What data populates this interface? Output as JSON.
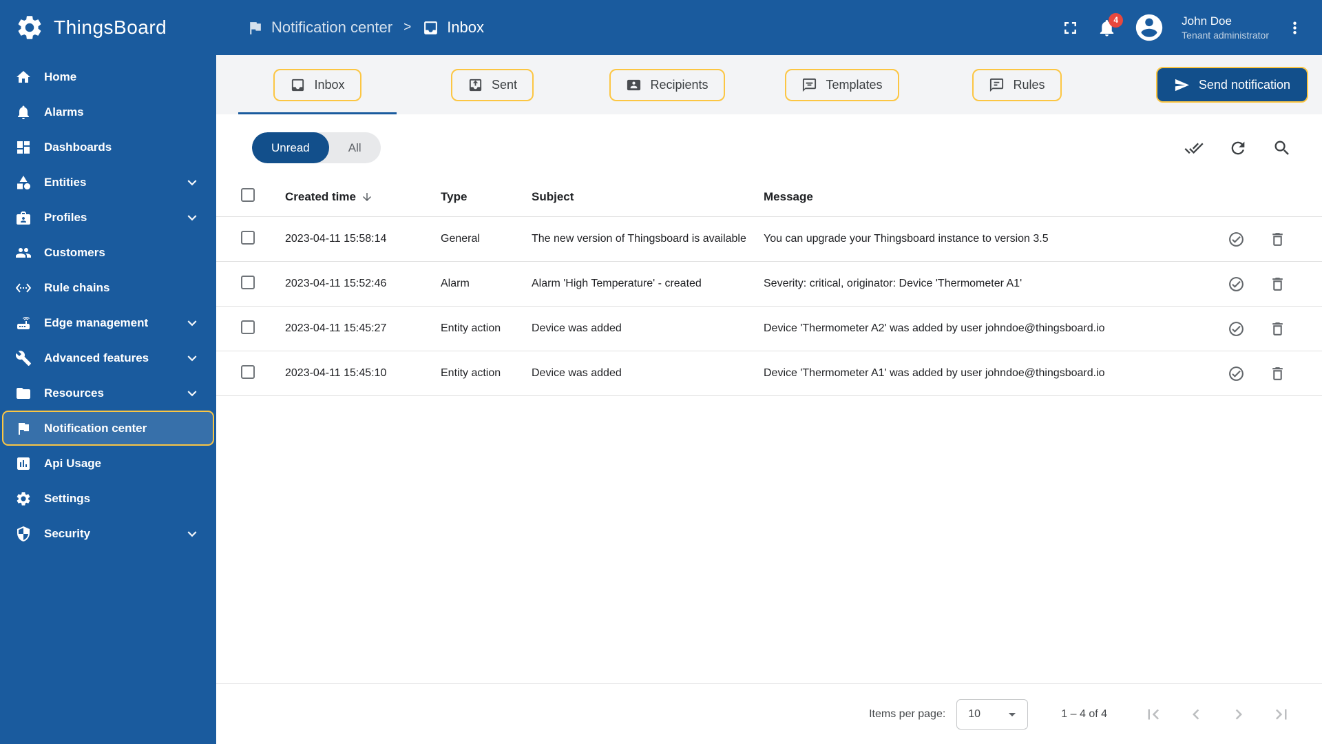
{
  "app": {
    "title": "ThingsBoard"
  },
  "sidebar": {
    "items": [
      {
        "label": "Home",
        "icon": "home"
      },
      {
        "label": "Alarms",
        "icon": "bell"
      },
      {
        "label": "Dashboards",
        "icon": "dashboards"
      },
      {
        "label": "Entities",
        "icon": "entities",
        "expandable": true
      },
      {
        "label": "Profiles",
        "icon": "profiles",
        "expandable": true
      },
      {
        "label": "Customers",
        "icon": "customers"
      },
      {
        "label": "Rule chains",
        "icon": "rule-chains"
      },
      {
        "label": "Edge management",
        "icon": "edge-management",
        "expandable": true
      },
      {
        "label": "Advanced features",
        "icon": "advanced-features",
        "expandable": true
      },
      {
        "label": "Resources",
        "icon": "resources",
        "expandable": true
      },
      {
        "label": "Notification center",
        "icon": "notification-center",
        "active": true
      },
      {
        "label": "Api Usage",
        "icon": "api-usage"
      },
      {
        "label": "Settings",
        "icon": "settings"
      },
      {
        "label": "Security",
        "icon": "security",
        "expandable": true
      }
    ]
  },
  "header": {
    "breadcrumb": {
      "parent": "Notification center",
      "separator": ">",
      "current": "Inbox"
    },
    "notifications_badge": "4",
    "user": {
      "name": "John Doe",
      "role": "Tenant administrator"
    }
  },
  "tabs": [
    {
      "label": "Inbox",
      "icon": "inbox",
      "active": true
    },
    {
      "label": "Sent",
      "icon": "sent"
    },
    {
      "label": "Recipients",
      "icon": "recipients"
    },
    {
      "label": "Templates",
      "icon": "templates"
    },
    {
      "label": "Rules",
      "icon": "rules"
    }
  ],
  "actions": {
    "send_notification": "Send notification"
  },
  "toolbar": {
    "filter_unread": "Unread",
    "filter_all": "All",
    "selected_filter": "Unread"
  },
  "table": {
    "columns": {
      "created_time": "Created time",
      "type": "Type",
      "subject": "Subject",
      "message": "Message"
    },
    "rows": [
      {
        "time": "2023-04-11 15:58:14",
        "type": "General",
        "subject": "The new version of Thingsboard is available",
        "message": "You can upgrade your Thingsboard instance to version 3.5"
      },
      {
        "time": "2023-04-11 15:52:46",
        "type": "Alarm",
        "subject": "Alarm 'High Temperature' - created",
        "message": "Severity: critical, originator: Device 'Thermometer A1'"
      },
      {
        "time": "2023-04-11 15:45:27",
        "type": "Entity action",
        "subject": "Device was added",
        "message": "Device 'Thermometer A2' was added by user johndoe@thingsboard.io"
      },
      {
        "time": "2023-04-11 15:45:10",
        "type": "Entity action",
        "subject": "Device was added",
        "message": "Device 'Thermometer A1' was added by user johndoe@thingsboard.io"
      }
    ]
  },
  "pagination": {
    "items_per_page_label": "Items per page:",
    "items_per_page_value": "10",
    "range_label": "1 – 4 of 4"
  },
  "colors": {
    "primary": "#1a5b9e",
    "accent": "#fcc643",
    "badge_red": "#e7483d"
  }
}
